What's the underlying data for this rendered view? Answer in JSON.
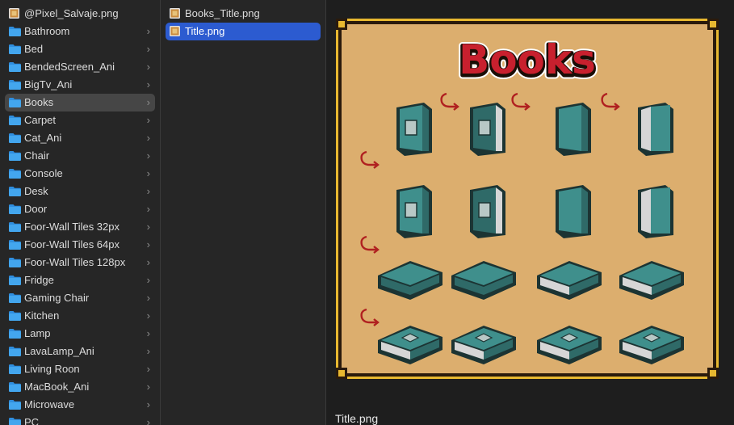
{
  "sidebar": {
    "items": [
      {
        "label": "@Pixel_Salvaje.png",
        "type": "image",
        "chevron": false
      },
      {
        "label": "Bathroom",
        "type": "folder",
        "chevron": true
      },
      {
        "label": "Bed",
        "type": "folder",
        "chevron": true
      },
      {
        "label": "BendedScreen_Ani",
        "type": "folder",
        "chevron": true
      },
      {
        "label": "BigTv_Ani",
        "type": "folder",
        "chevron": true
      },
      {
        "label": "Books",
        "type": "folder",
        "chevron": true,
        "selected": true
      },
      {
        "label": "Carpet",
        "type": "folder",
        "chevron": true
      },
      {
        "label": "Cat_Ani",
        "type": "folder",
        "chevron": true
      },
      {
        "label": "Chair",
        "type": "folder",
        "chevron": true
      },
      {
        "label": "Console",
        "type": "folder",
        "chevron": true
      },
      {
        "label": "Desk",
        "type": "folder",
        "chevron": true
      },
      {
        "label": "Door",
        "type": "folder",
        "chevron": true
      },
      {
        "label": "Foor-Wall Tiles 32px",
        "type": "folder",
        "chevron": true
      },
      {
        "label": "Foor-Wall Tiles 64px",
        "type": "folder",
        "chevron": true
      },
      {
        "label": "Foor-Wall Tiles 128px",
        "type": "folder",
        "chevron": true
      },
      {
        "label": "Fridge",
        "type": "folder",
        "chevron": true
      },
      {
        "label": "Gaming Chair",
        "type": "folder",
        "chevron": true
      },
      {
        "label": "Kitchen",
        "type": "folder",
        "chevron": true
      },
      {
        "label": "Lamp",
        "type": "folder",
        "chevron": true
      },
      {
        "label": "LavaLamp_Ani",
        "type": "folder",
        "chevron": true
      },
      {
        "label": "Living Roon",
        "type": "folder",
        "chevron": true
      },
      {
        "label": "MacBook_Ani",
        "type": "folder",
        "chevron": true
      },
      {
        "label": "Microwave",
        "type": "folder",
        "chevron": true
      },
      {
        "label": "PC",
        "type": "folder",
        "chevron": true
      }
    ],
    "chevron_glyph": "›"
  },
  "files": {
    "items": [
      {
        "label": "Books_Title.png",
        "selected": false
      },
      {
        "label": "Title.png",
        "selected": true
      }
    ]
  },
  "preview": {
    "title_art": "Books",
    "caption": "Title.png"
  },
  "colors": {
    "accent_blue": "#2c5bd0",
    "folder_blue": "#43a6ee",
    "sheet_bg": "#dcae6e",
    "frame_dark": "#2a1a0c",
    "frame_gold": "#e8b830",
    "book_teal": "#3f8f8c",
    "arrow_red": "#b02020"
  }
}
